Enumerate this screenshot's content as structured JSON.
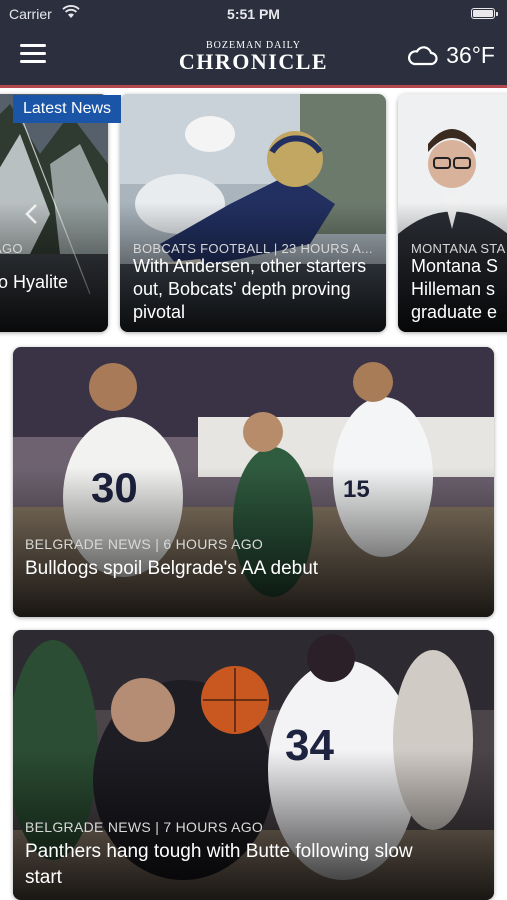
{
  "status_bar": {
    "carrier": "Carrier",
    "time": "5:51 PM"
  },
  "nav": {
    "logo_top": "BOZEMAN DAILY",
    "logo_main": "CHRONICLE",
    "temperature": "36°F",
    "weather_icon": "cloud-icon",
    "menu_icon": "hamburger-menu-icon",
    "accent_color": "#b4464d",
    "bar_color": "#2b2f3e"
  },
  "carousel": {
    "badge": "Latest News",
    "badge_color": "#1b55a8",
    "cards": [
      {
        "meta": "AGO",
        "headline": "to Hyalite"
      },
      {
        "meta": "BOBCATS FOOTBALL | 23 HOURS A...",
        "headline": "With Andersen, other starters out, Bobcats' depth proving pivotal"
      },
      {
        "meta": "MONTANA STA",
        "headline": "Montana S Hilleman s graduate e"
      }
    ]
  },
  "feed": [
    {
      "meta": "BELGRADE NEWS | 6 HOURS AGO",
      "headline": "Bulldogs spoil Belgrade's AA debut"
    },
    {
      "meta": "BELGRADE NEWS | 7 HOURS AGO",
      "headline": "Panthers hang tough with Butte following slow start"
    }
  ]
}
